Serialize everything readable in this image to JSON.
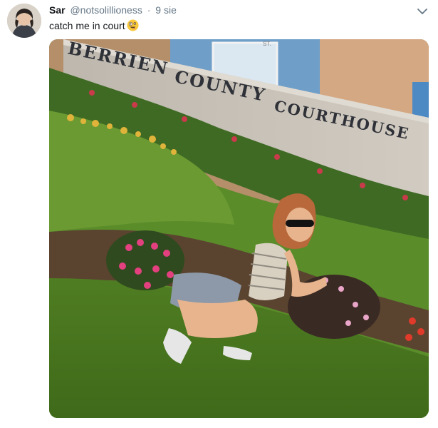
{
  "tweet": {
    "display_name": "Sar",
    "handle": "@notsolillioness",
    "separator": "·",
    "date": "9 sie",
    "text": "catch me in court",
    "emoji": "zany-face-emoji"
  },
  "icons": {
    "avatar": "profile-avatar",
    "menu": "chevron-down-icon"
  },
  "media": {
    "sign_line1": "BERRIEN",
    "sign_line2": "COUNTY",
    "sign_line3": "COURTHOUSE",
    "building_plate": "ST."
  },
  "colors": {
    "secondary_text": "#657786",
    "primary_text": "#14171a"
  }
}
